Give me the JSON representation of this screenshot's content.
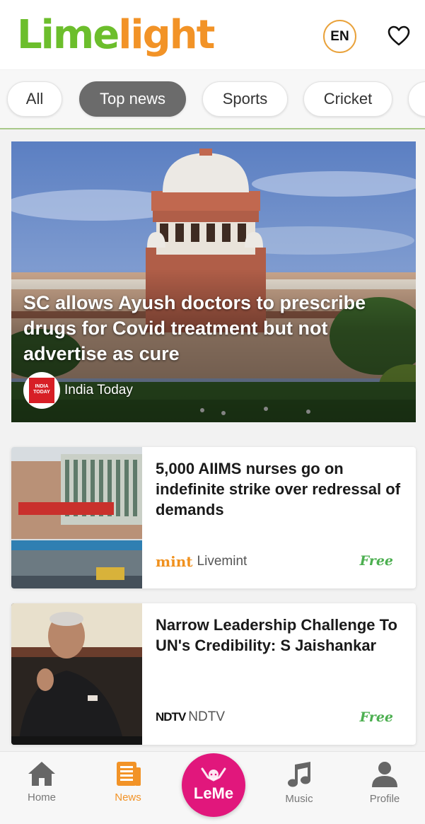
{
  "header": {
    "logo_part1": "Lime",
    "logo_part2": "light",
    "language": "EN",
    "favorite_icon": "heart-icon"
  },
  "tabs": [
    {
      "label": "All",
      "active": false
    },
    {
      "label": "Top news",
      "active": true
    },
    {
      "label": "Sports",
      "active": false
    },
    {
      "label": "Cricket",
      "active": false
    }
  ],
  "hero": {
    "title": "SC allows Ayush doctors to prescribe drugs for Covid treatment but not advertise as cure",
    "source": "India Today",
    "source_logo_text": "INDIA TODAY"
  },
  "articles": [
    {
      "title": "5,000 AIIMS nurses go on indefinite strike over redressal of demands",
      "source": "Livemint",
      "source_logo": "mint",
      "badge": "Free"
    },
    {
      "title": "Narrow Leadership Challenge To UN's Credibility: S Jaishankar",
      "source": "NDTV",
      "source_logo": "NDTV",
      "badge": "Free"
    }
  ],
  "bottom_nav": {
    "home": "Home",
    "news": "News",
    "center": "LeMe",
    "music": "Music",
    "profile": "Profile"
  },
  "colors": {
    "brand_green": "#6cbe2c",
    "brand_orange": "#f29327",
    "leme_pink": "#e1177c",
    "free_green": "#4caf50"
  }
}
